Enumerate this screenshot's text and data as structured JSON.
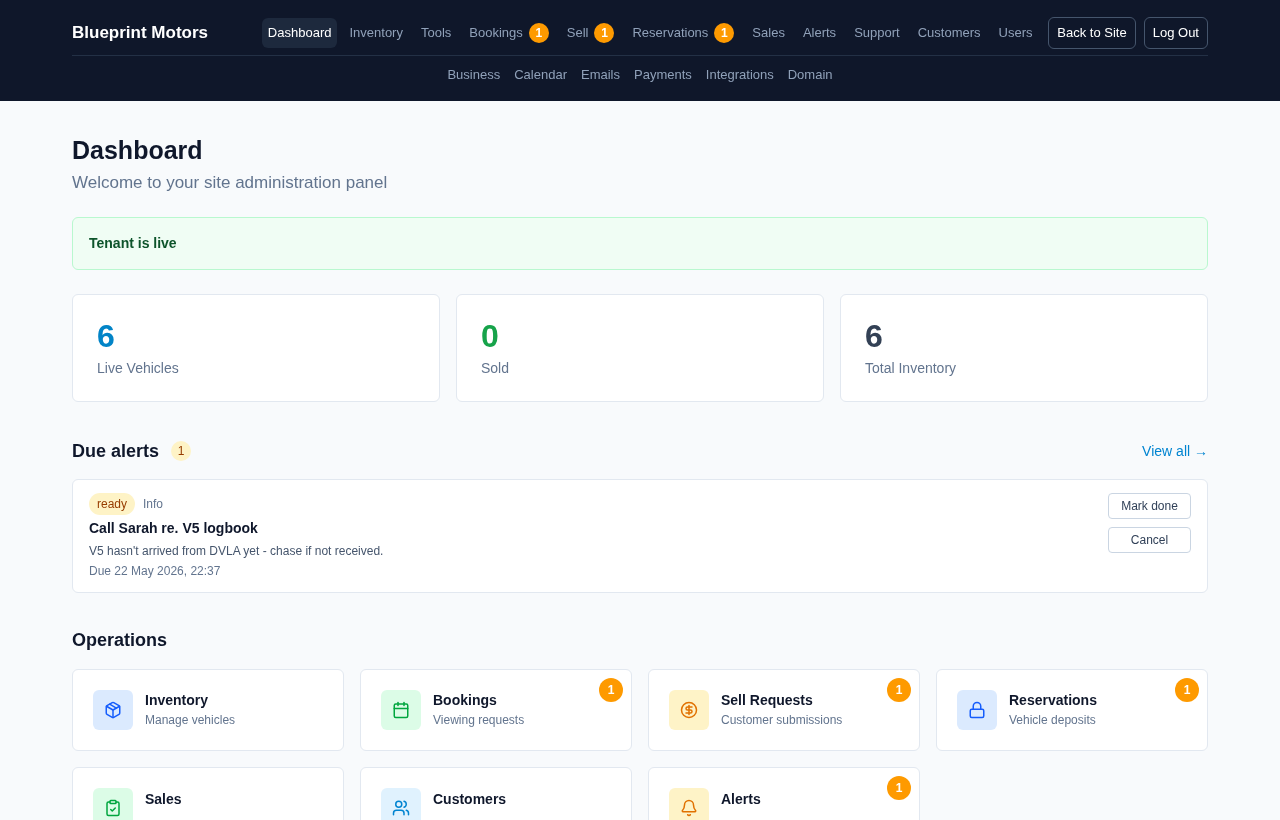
{
  "brand": "Blueprint Motors",
  "nav": [
    {
      "label": "Dashboard",
      "selected": true
    },
    {
      "label": "Inventory",
      "selected": false
    },
    {
      "label": "Tools",
      "selected": false
    },
    {
      "label": "Bookings",
      "selected": false,
      "count": "1"
    },
    {
      "label": "Sell",
      "selected": false,
      "count": "1"
    },
    {
      "label": "Reservations",
      "selected": false,
      "count": "1"
    },
    {
      "label": "Sales",
      "selected": false
    },
    {
      "label": "Alerts",
      "selected": false
    },
    {
      "label": "Support",
      "selected": false
    },
    {
      "label": "Customers",
      "selected": false
    },
    {
      "label": "Users",
      "selected": false
    }
  ],
  "subnav": [
    "Business",
    "Calendar",
    "Emails",
    "Payments",
    "Integrations",
    "Domain"
  ],
  "header_buttons": [
    "Back to Site",
    "Log Out"
  ],
  "page": {
    "title": "Dashboard",
    "subtitle": "Welcome to your site administration panel"
  },
  "status_banner": "Tenant is live",
  "stats": [
    {
      "value": "6",
      "label": "Live Vehicles",
      "color": "#0284c7"
    },
    {
      "value": "0",
      "label": "Sold",
      "color": "#16a34a"
    },
    {
      "value": "6",
      "label": "Total Inventory",
      "color": "#334155"
    }
  ],
  "alerts": {
    "title": "Due alerts",
    "count": "1",
    "view_all": "View all →",
    "items": [
      {
        "status": "ready",
        "type": "Info",
        "title": "Call Sarah re. V5 logbook",
        "description": "V5 hasn't arrived from DVLA yet - chase if not received.",
        "due": "Due 22 May 2026, 22:37",
        "actions": [
          "Mark done",
          "Cancel"
        ]
      }
    ]
  },
  "operations": {
    "title": "Operations",
    "cards": [
      {
        "kind": "box",
        "title": "Inventory",
        "subtitle": "Manage vehicles",
        "color": "#dbeafe"
      },
      {
        "kind": "calendar",
        "title": "Bookings",
        "subtitle": "Viewing requests",
        "color": "#dcfce7",
        "count": "1"
      },
      {
        "kind": "coin",
        "title": "Sell Requests",
        "subtitle": "Customer submissions",
        "color": "#fef3c7",
        "count": "1"
      },
      {
        "kind": "lock",
        "title": "Reservations",
        "subtitle": "Vehicle deposits",
        "color": "#dbeafe",
        "count": "1"
      },
      {
        "kind": "clipboard",
        "title": "Sales",
        "color": "#dcfce7"
      },
      {
        "kind": "people",
        "title": "Customers",
        "color": "#e0f2fe"
      },
      {
        "kind": "bell",
        "title": "Alerts",
        "color": "#fef3c7",
        "count": "1"
      }
    ]
  }
}
